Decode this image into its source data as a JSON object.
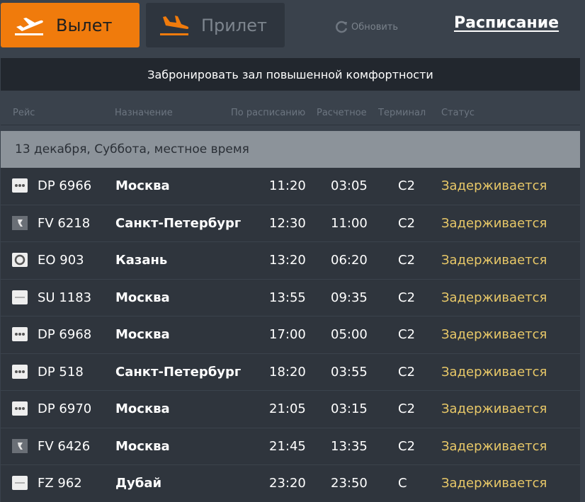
{
  "header": {
    "departure_label": "Вылет",
    "arrival_label": "Прилет",
    "refresh_label": "Обновить",
    "schedule_label": "Расписание"
  },
  "lounge_banner": "Забронировать зал повышенной комфортности",
  "columns": {
    "flight": "Рейс",
    "destination": "Назначение",
    "scheduled": "По расписанию",
    "estimated": "Расчетное",
    "terminal": "Терминал",
    "status": "Статус"
  },
  "date_header": "13 декабря, Суббота, местное время",
  "colors": {
    "accent": "#f07b0c",
    "status_delayed": "#e8c868"
  },
  "flights": [
    {
      "logo": "dots-logo-icon",
      "flight": "DP 6966",
      "destination": "Москва",
      "scheduled": "11:20",
      "estimated": "03:05",
      "terminal": "C2",
      "status": "Задерживается"
    },
    {
      "logo": "r-logo-icon",
      "flight": "FV 6218",
      "destination": "Санкт-Петербург",
      "scheduled": "12:30",
      "estimated": "11:00",
      "terminal": "C2",
      "status": "Задерживается"
    },
    {
      "logo": "ring-logo-icon",
      "flight": "EO 903",
      "destination": "Казань",
      "scheduled": "13:20",
      "estimated": "06:20",
      "terminal": "C2",
      "status": "Задерживается"
    },
    {
      "logo": "line-logo-icon",
      "flight": "SU 1183",
      "destination": "Москва",
      "scheduled": "13:55",
      "estimated": "09:35",
      "terminal": "C2",
      "status": "Задерживается"
    },
    {
      "logo": "dots-logo-icon",
      "flight": "DP 6968",
      "destination": "Москва",
      "scheduled": "17:00",
      "estimated": "05:00",
      "terminal": "C2",
      "status": "Задерживается"
    },
    {
      "logo": "dots-logo-icon",
      "flight": "DP 518",
      "destination": "Санкт-Петербург",
      "scheduled": "18:20",
      "estimated": "03:55",
      "terminal": "C2",
      "status": "Задерживается"
    },
    {
      "logo": "dots-logo-icon",
      "flight": "DP 6970",
      "destination": "Москва",
      "scheduled": "21:05",
      "estimated": "03:15",
      "terminal": "C2",
      "status": "Задерживается"
    },
    {
      "logo": "r-logo-icon",
      "flight": "FV 6426",
      "destination": "Москва",
      "scheduled": "21:45",
      "estimated": "13:35",
      "terminal": "C2",
      "status": "Задерживается"
    },
    {
      "logo": "line-logo-icon",
      "flight": "FZ 962",
      "destination": "Дубай",
      "scheduled": "23:20",
      "estimated": "23:50",
      "terminal": "C",
      "status": "Задерживается"
    }
  ]
}
